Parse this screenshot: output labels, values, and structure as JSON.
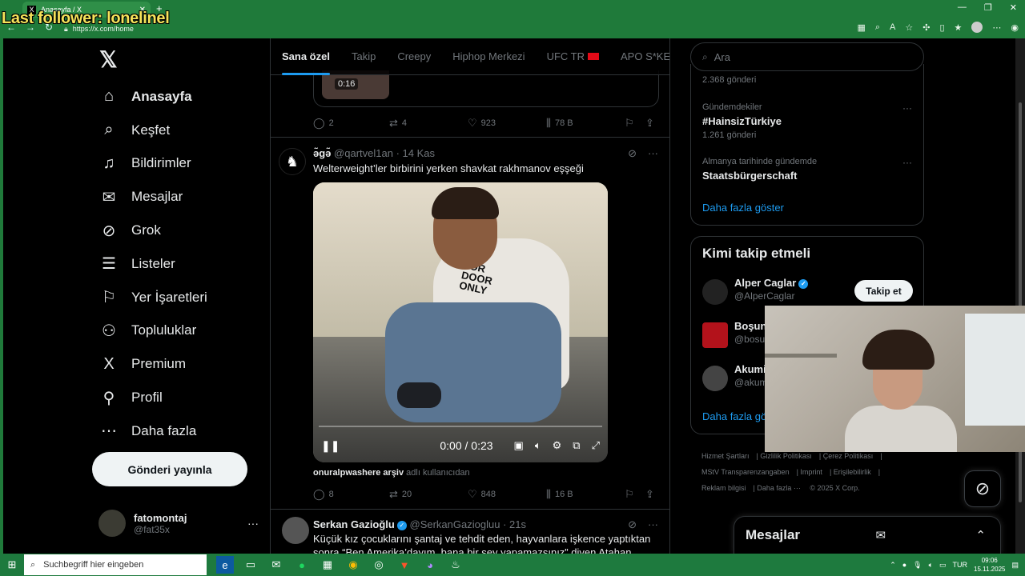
{
  "overlay_text": "Last follower: lonelinel",
  "browser": {
    "tab_title": "Anasayfa / X",
    "tab_favicon": "X",
    "url": "https://x.com/home",
    "new_tab": "+"
  },
  "sidebar": {
    "items": [
      {
        "label": "Anasayfa",
        "icon": "home-icon",
        "glyph": "⌂"
      },
      {
        "label": "Keşfet",
        "icon": "search-icon",
        "glyph": "⌕"
      },
      {
        "label": "Bildirimler",
        "icon": "bell-icon",
        "glyph": "♫"
      },
      {
        "label": "Mesajlar",
        "icon": "mail-icon",
        "glyph": "✉"
      },
      {
        "label": "Grok",
        "icon": "grok-icon",
        "glyph": "⊘"
      },
      {
        "label": "Listeler",
        "icon": "list-icon",
        "glyph": "☰"
      },
      {
        "label": "Yer İşaretleri",
        "icon": "bookmark-icon",
        "glyph": "⚐"
      },
      {
        "label": "Topluluklar",
        "icon": "communities-icon",
        "glyph": "⚇"
      },
      {
        "label": "Premium",
        "icon": "x-premium-icon",
        "glyph": "X"
      },
      {
        "label": "Profil",
        "icon": "profile-icon",
        "glyph": "⚲"
      },
      {
        "label": "Daha fazla",
        "icon": "more-circle-icon",
        "glyph": "⋯"
      }
    ],
    "post_button": "Gönderi yayınla",
    "account": {
      "name": "fatomontaj",
      "handle": "@fat35x"
    }
  },
  "feed_tabs": [
    "Sana özel",
    "Takip",
    "Creepy",
    "Hiphop Merkezi",
    "UFC TR",
    "APO S*KEN"
  ],
  "previous_post": {
    "duration": "0:16",
    "replies": "2",
    "reposts": "4",
    "likes": "923",
    "views": "78 B"
  },
  "tweet1": {
    "name": "ə̃gə̃",
    "handle": "@qartvel1an",
    "time": "· 14 Kas",
    "text": "Welterweight’ler birbirini yerken shavkat rakhmanov eşşeği",
    "video_time": "0:00 / 0:23",
    "source_name": "onuralpwashere arşiv",
    "source_suffix": "adlı kullanıcıdan",
    "replies": "8",
    "reposts": "20",
    "likes": "848",
    "views": "16 B"
  },
  "tweet2": {
    "name": "Serkan Gazioğlu",
    "handle": "@SerkanGaziogluu",
    "time": "· 21s",
    "text": "Küçük kız çocuklarını şantaj ve tehdit eden, hayvanlara işkence yaptıktan sonra “Ben Amerika’dayım, bana bir şey yapamazsınız” diyen Atahan"
  },
  "search": {
    "placeholder": "Ara"
  },
  "trends": [
    {
      "meta": "",
      "title": "",
      "count": "2.368 gönderi"
    },
    {
      "meta": "Gündemdekiler",
      "title": "#HainsizTürkiye",
      "count": "1.261 gönderi"
    },
    {
      "meta": "Almanya tarihinde gündemde",
      "title": "Staatsbürgerschaft",
      "count": ""
    }
  ],
  "show_more": "Daha fazla göster",
  "who_to_follow": {
    "title": "Kimi takip etmeli",
    "users": [
      {
        "name": "Alper Caglar",
        "handle": "@AlperCaglar"
      },
      {
        "name": "Boşun",
        "handle": "@bosu"
      },
      {
        "name": "Akumi",
        "handle": "@akum"
      }
    ],
    "follow_label": "Takip et",
    "show_more": "Daha fazla gös"
  },
  "footer": {
    "links": [
      "Hizmet Şartları",
      "Gizlilik Politikası",
      "Çerez Politikası",
      "MStV Transparenzangaben",
      "Imprint",
      "Erişilebilirlik",
      "Reklam bilgisi",
      "Daha fazla ···",
      "© 2025 X Corp."
    ]
  },
  "messages_drawer": {
    "title": "Mesajlar"
  },
  "taskbar": {
    "search_placeholder": "Suchbegriff hier eingeben",
    "lang": "TUR",
    "time": "09:06",
    "date": "15.11.2025"
  },
  "colors": {
    "accent": "#1d9bf0",
    "browser_green": "#1f7a3a",
    "overlay_yellow": "#f5e35a"
  }
}
